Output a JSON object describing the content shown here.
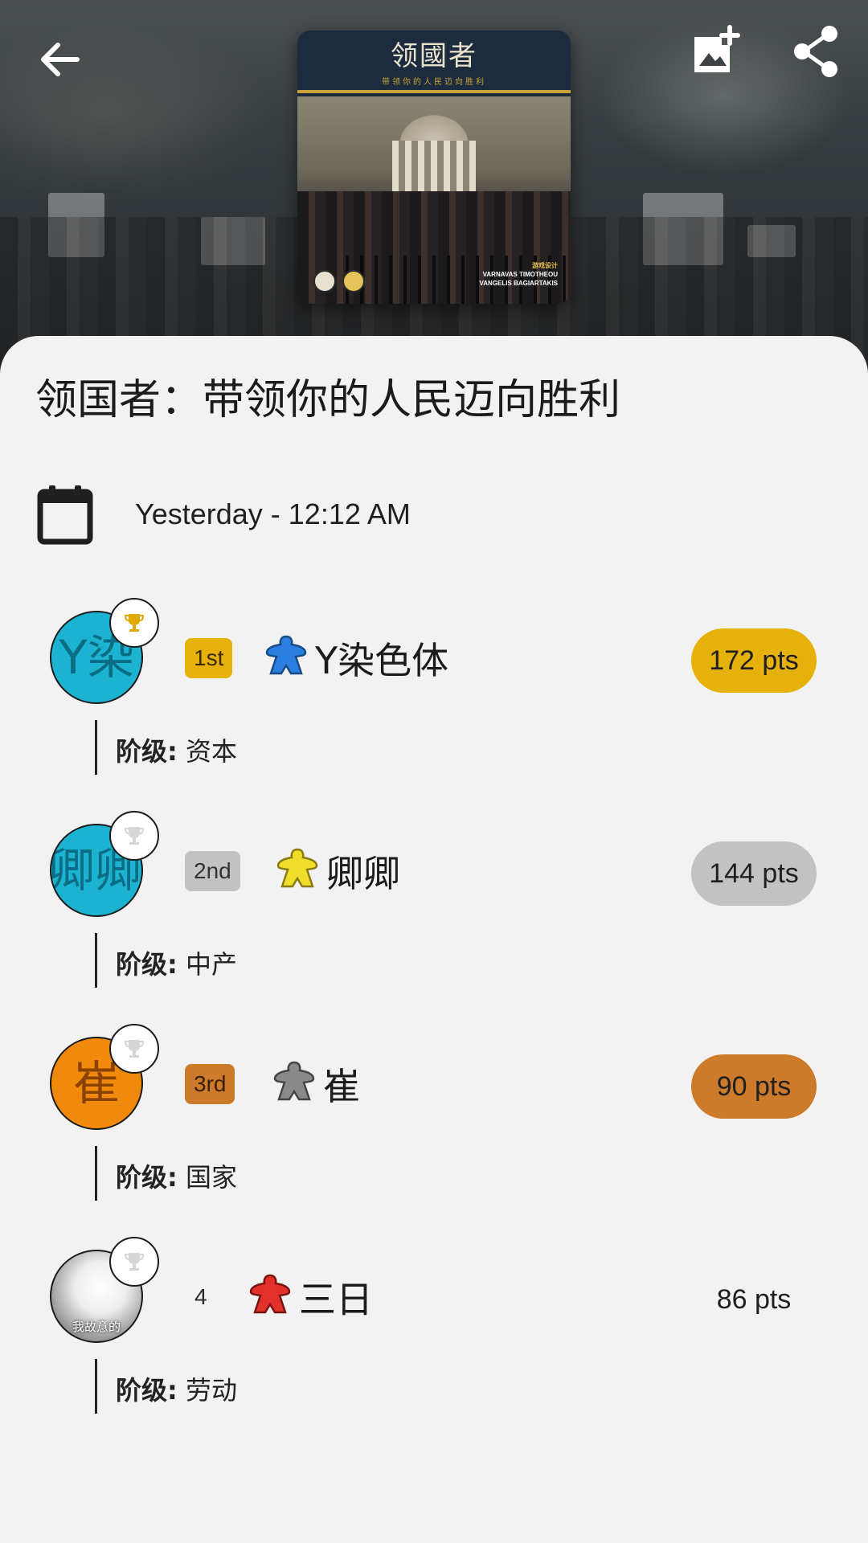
{
  "header": {
    "back_icon": "arrow-left-icon",
    "add_photo_icon": "add-photo-icon",
    "share_icon": "share-icon",
    "cover": {
      "title": "领國者",
      "subtitle": "带领你的人民迈向胜利",
      "designer_label": "游戏设计",
      "designer_1": "VARNAVAS TIMOTHEOU",
      "designer_2": "VANGELIS BAGIARTAKIS"
    }
  },
  "game": {
    "title": "领国者：带领你的人民迈向胜利",
    "date": "Yesterday - 12:12 AM"
  },
  "players": [
    {
      "avatar_text": "Y染",
      "avatar_color": "#1bb3d1",
      "rank": "1st",
      "rank_color": "#e6b10a",
      "meeple_color": "#2a7fe0",
      "name": "Y染色体",
      "points": "172 pts",
      "points_color": "#e6b10a",
      "winner": true,
      "attr_label": "阶级:",
      "attr_value": "资本"
    },
    {
      "avatar_text": "卿卿",
      "avatar_color": "#1bb3d1",
      "rank": "2nd",
      "rank_color": "#c2c2c2",
      "meeple_color": "#f0dc2a",
      "name": "卿卿",
      "points": "144 pts",
      "points_color": "#c2c2c2",
      "winner": false,
      "attr_label": "阶级:",
      "attr_value": "中产"
    },
    {
      "avatar_text": "崔",
      "avatar_color": "#f18a0c",
      "rank": "3rd",
      "rank_color": "#cd7b2a",
      "meeple_color": "#8a8a8a",
      "name": "崔",
      "points": "90 pts",
      "points_color": "#cd7b2a",
      "winner": false,
      "attr_label": "阶级:",
      "attr_value": "国家"
    },
    {
      "avatar_text": "我故意的",
      "avatar_color": "#9a9a9a",
      "rank": "4",
      "rank_color": "transparent",
      "meeple_color": "#e2302a",
      "name": "三日",
      "points": "86 pts",
      "points_color": "transparent",
      "winner": false,
      "attr_label": "阶级:",
      "attr_value": "劳动"
    }
  ]
}
